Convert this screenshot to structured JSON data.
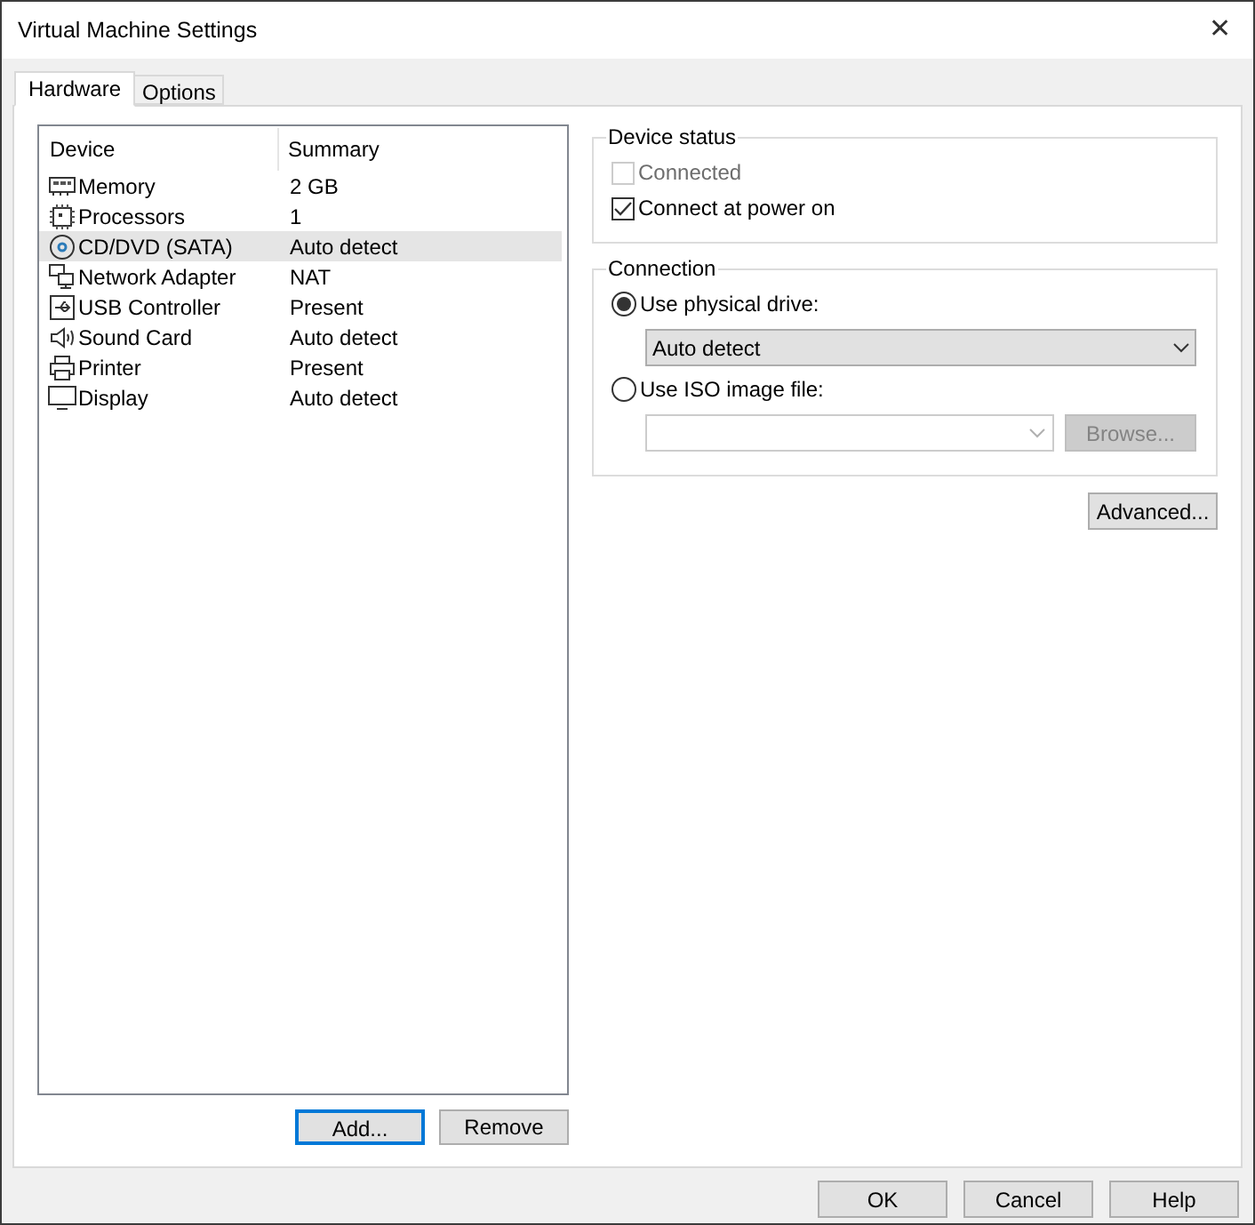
{
  "window": {
    "title": "Virtual Machine Settings",
    "close": "✕"
  },
  "tabs": [
    {
      "label": "Hardware",
      "selected": true
    },
    {
      "label": "Options",
      "selected": false
    }
  ],
  "devices": {
    "columns": [
      "Device",
      "Summary"
    ],
    "rows": [
      {
        "kind": "memory",
        "device": "Memory",
        "summary": "2 GB",
        "selected": false
      },
      {
        "kind": "processor",
        "device": "Processors",
        "summary": "1",
        "selected": false
      },
      {
        "kind": "cd",
        "device": "CD/DVD (SATA)",
        "summary": "Auto detect",
        "selected": true
      },
      {
        "kind": "network",
        "device": "Network Adapter",
        "summary": "NAT",
        "selected": false
      },
      {
        "kind": "usb",
        "device": "USB Controller",
        "summary": "Present",
        "selected": false
      },
      {
        "kind": "sound",
        "device": "Sound Card",
        "summary": "Auto detect",
        "selected": false
      },
      {
        "kind": "printer",
        "device": "Printer",
        "summary": "Present",
        "selected": false
      },
      {
        "kind": "display",
        "device": "Display",
        "summary": "Auto detect",
        "selected": false
      }
    ]
  },
  "list_buttons": [
    {
      "label": "Add...",
      "focused": true
    },
    {
      "label": "Remove",
      "focused": false
    }
  ],
  "device_status": {
    "title": "Device status",
    "options": [
      {
        "label": "Connected",
        "checked": false,
        "disabled": true
      },
      {
        "label": "Connect at power on",
        "checked": true,
        "disabled": false
      }
    ]
  },
  "connection": {
    "title": "Connection",
    "physical": {
      "label": "Use physical drive:",
      "selected": true,
      "value": "Auto detect"
    },
    "iso": {
      "label": "Use ISO image file:",
      "selected": false,
      "browse": "Browse..."
    }
  },
  "advanced_button": "Advanced...",
  "dialog_buttons": [
    {
      "label": "OK"
    },
    {
      "label": "Cancel"
    },
    {
      "label": "Help"
    }
  ]
}
